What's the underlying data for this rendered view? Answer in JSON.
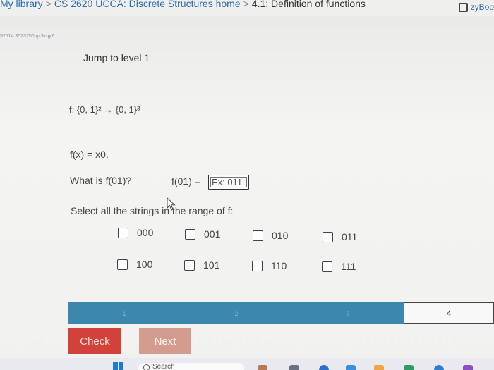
{
  "header": {
    "breadcrumb": [
      {
        "label": "My library"
      },
      {
        "label": "CS 2620 UCCA: Discrete Structures home"
      },
      {
        "label": "4.1: Definition of functions"
      }
    ],
    "breadcrumb_separator": ">",
    "brand_label": "zyBoo"
  },
  "activity": {
    "id_text": "52514.3523750.qx3zqy7",
    "jump_label": "Jump to level 1"
  },
  "problem": {
    "function_def": "f: {0, 1}² → {0, 1}³",
    "rule": "f(x) = x0.",
    "question": "What is f(01)?",
    "answer_label": "f(01) =",
    "answer_value": "",
    "answer_placeholder": "Ex: 011",
    "select_prompt": "Select all the strings in the range of f:",
    "options": [
      {
        "label": "000",
        "checked": false
      },
      {
        "label": "001",
        "checked": false
      },
      {
        "label": "010",
        "checked": false
      },
      {
        "label": "011",
        "checked": false
      },
      {
        "label": "100",
        "checked": false
      },
      {
        "label": "101",
        "checked": false
      },
      {
        "label": "110",
        "checked": false
      },
      {
        "label": "111",
        "checked": false
      }
    ]
  },
  "levels": {
    "items": [
      "1",
      "2",
      "3",
      "4"
    ],
    "current": "4",
    "completed_color": "#3c87ad"
  },
  "actions": {
    "check_label": "Check",
    "next_label": "Next",
    "check_color": "#d2423a",
    "next_color": "#d39c8e"
  },
  "taskbar": {
    "search_label": "Search"
  }
}
